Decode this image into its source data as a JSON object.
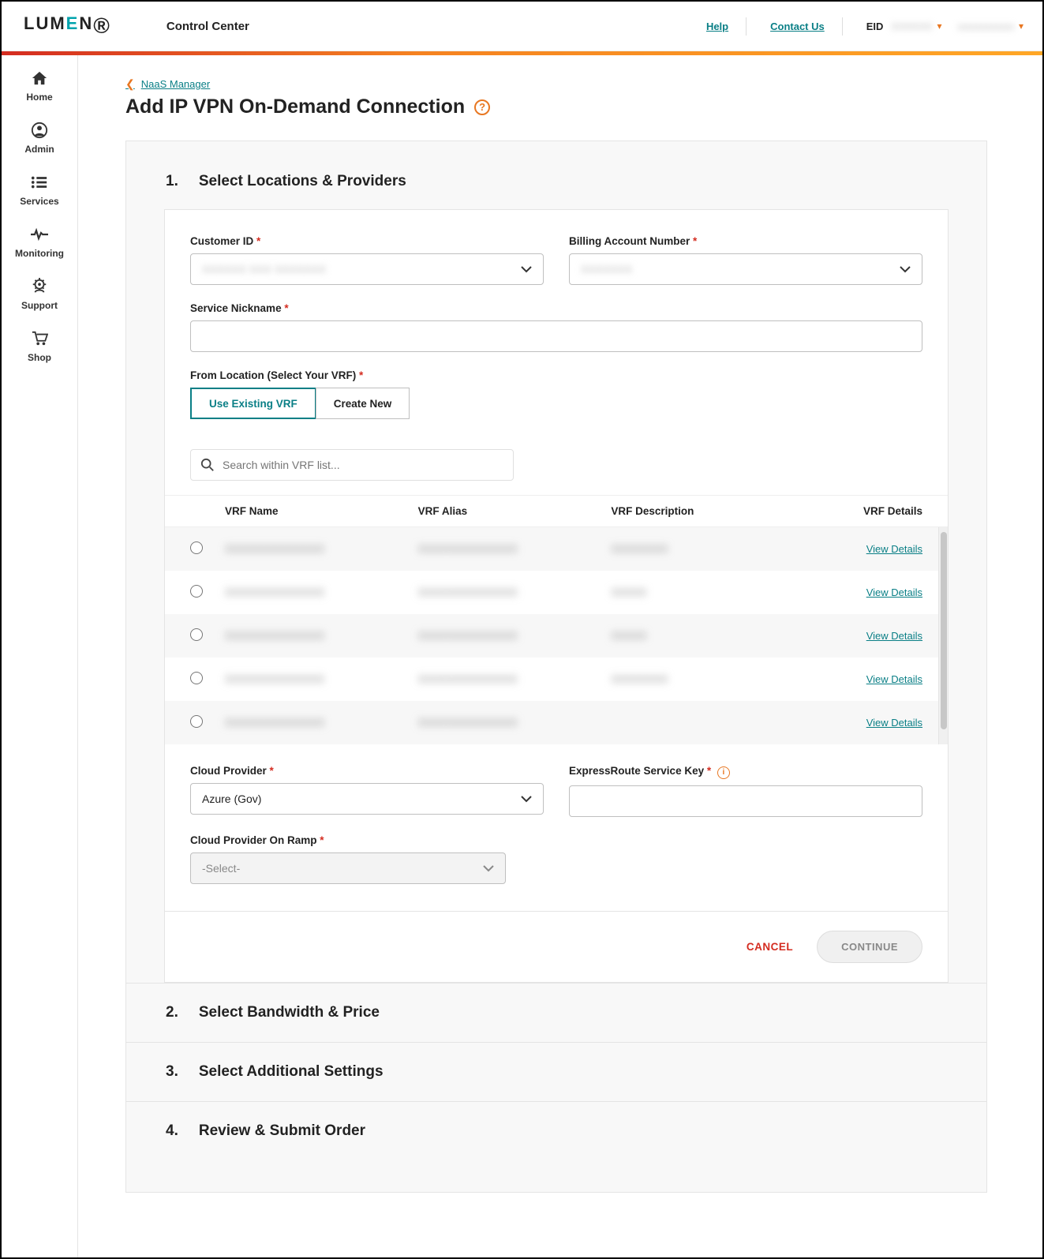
{
  "header": {
    "brand": "LUMEN",
    "app_title": "Control Center",
    "help_label": "Help",
    "contact_label": "Contact Us",
    "eid_prefix": "EID",
    "eid_value": "XXXXXX",
    "acct_value": "xxxxxxxxxxx"
  },
  "sidebar": {
    "items": [
      {
        "label": "Home"
      },
      {
        "label": "Admin"
      },
      {
        "label": "Services"
      },
      {
        "label": "Monitoring"
      },
      {
        "label": "Support"
      },
      {
        "label": "Shop"
      }
    ]
  },
  "breadcrumb": {
    "back_label": "NaaS Manager"
  },
  "page": {
    "title": "Add IP VPN On-Demand Connection",
    "steps": {
      "s1_num": "1.",
      "s1_title": "Select Locations & Providers",
      "s2_num": "2.",
      "s2_title": "Select Bandwidth & Price",
      "s3_num": "3.",
      "s3_title": "Select Additional Settings",
      "s4_num": "4.",
      "s4_title": "Review & Submit Order"
    }
  },
  "form": {
    "customer_id_label": "Customer ID",
    "customer_id_value": "XXXXXX XXX XXXXXXX",
    "ban_label": "Billing Account Number",
    "ban_value": "XXXXXXX",
    "nickname_label": "Service Nickname",
    "from_label": "From Location (Select Your VRF)",
    "toggle_existing": "Use Existing VRF",
    "toggle_create": "Create New",
    "search_placeholder": "Search within VRF list...",
    "cloud_provider_label": "Cloud Provider",
    "cloud_provider_value": "Azure (Gov)",
    "ersk_label": "ExpressRoute Service Key",
    "onramp_label": "Cloud Provider On Ramp",
    "onramp_placeholder": "-Select-"
  },
  "vrf_table": {
    "headers": {
      "name": "VRF Name",
      "alias": "VRF Alias",
      "desc": "VRF Description",
      "details": "VRF Details"
    },
    "view_details": "View Details",
    "rows": [
      {
        "name": "XXXXXXXXXXXXXX",
        "alias": "XXXXXXXXXXXXXX",
        "desc": "XXXXXXXX"
      },
      {
        "name": "XXXXXXXXXXXXXX",
        "alias": "XXXXXXXXXXXXXX",
        "desc": "XXXXX"
      },
      {
        "name": "XXXXXXXXXXXXXX",
        "alias": "XXXXXXXXXXXXXX",
        "desc": "XXXXX"
      },
      {
        "name": "XXXXXXXXXXXXXX",
        "alias": "XXXXXXXXXXXXXX",
        "desc": "XXXXXXXX"
      },
      {
        "name": "XXXXXXXXXXXXXX",
        "alias": "XXXXXXXXXXXXXX",
        "desc": ""
      }
    ]
  },
  "actions": {
    "cancel": "CANCEL",
    "continue": "CONTINUE"
  }
}
